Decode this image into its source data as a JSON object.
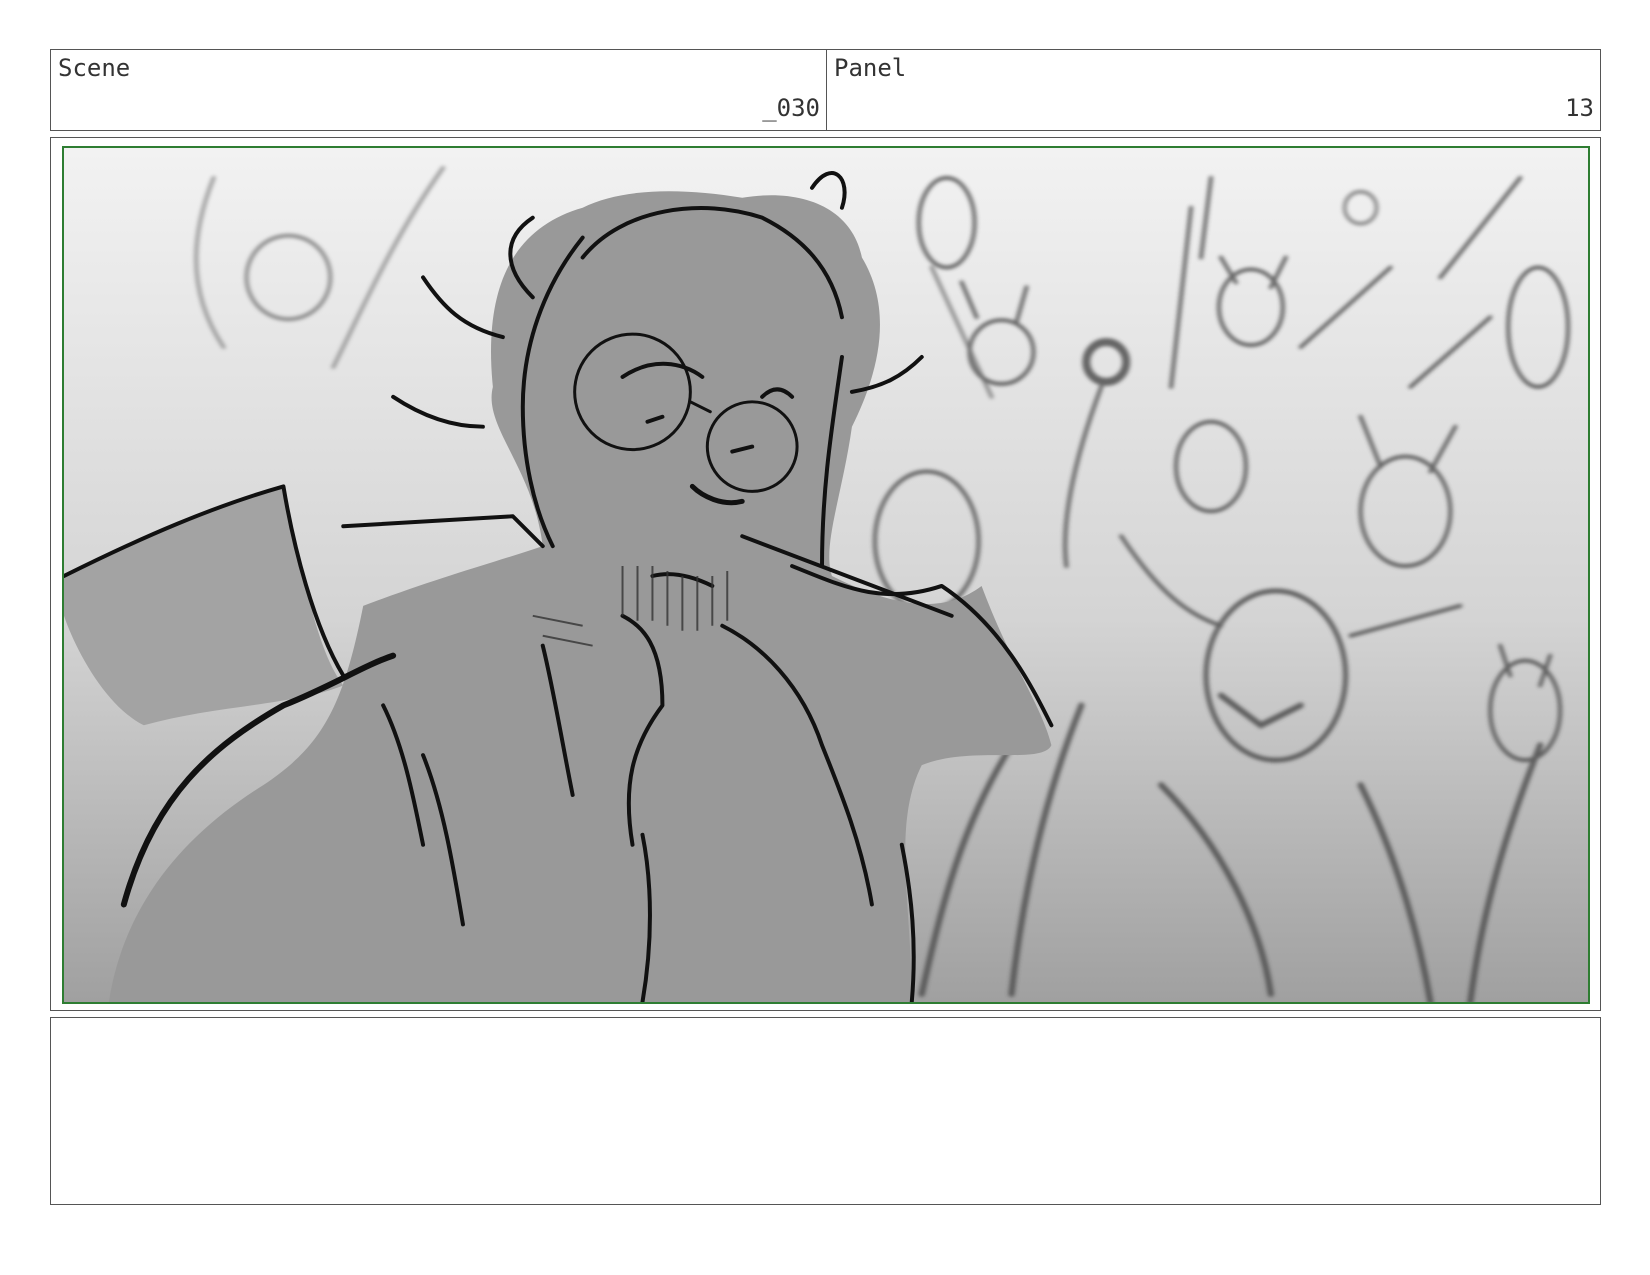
{
  "header": {
    "scene_label": "Scene",
    "scene_value": "_030",
    "panel_label": "Panel",
    "panel_value": "13"
  },
  "artwork": {
    "description_icon": "storyboard-sketch",
    "frame_color": "#2e7d32"
  },
  "notes": {
    "text": ""
  }
}
